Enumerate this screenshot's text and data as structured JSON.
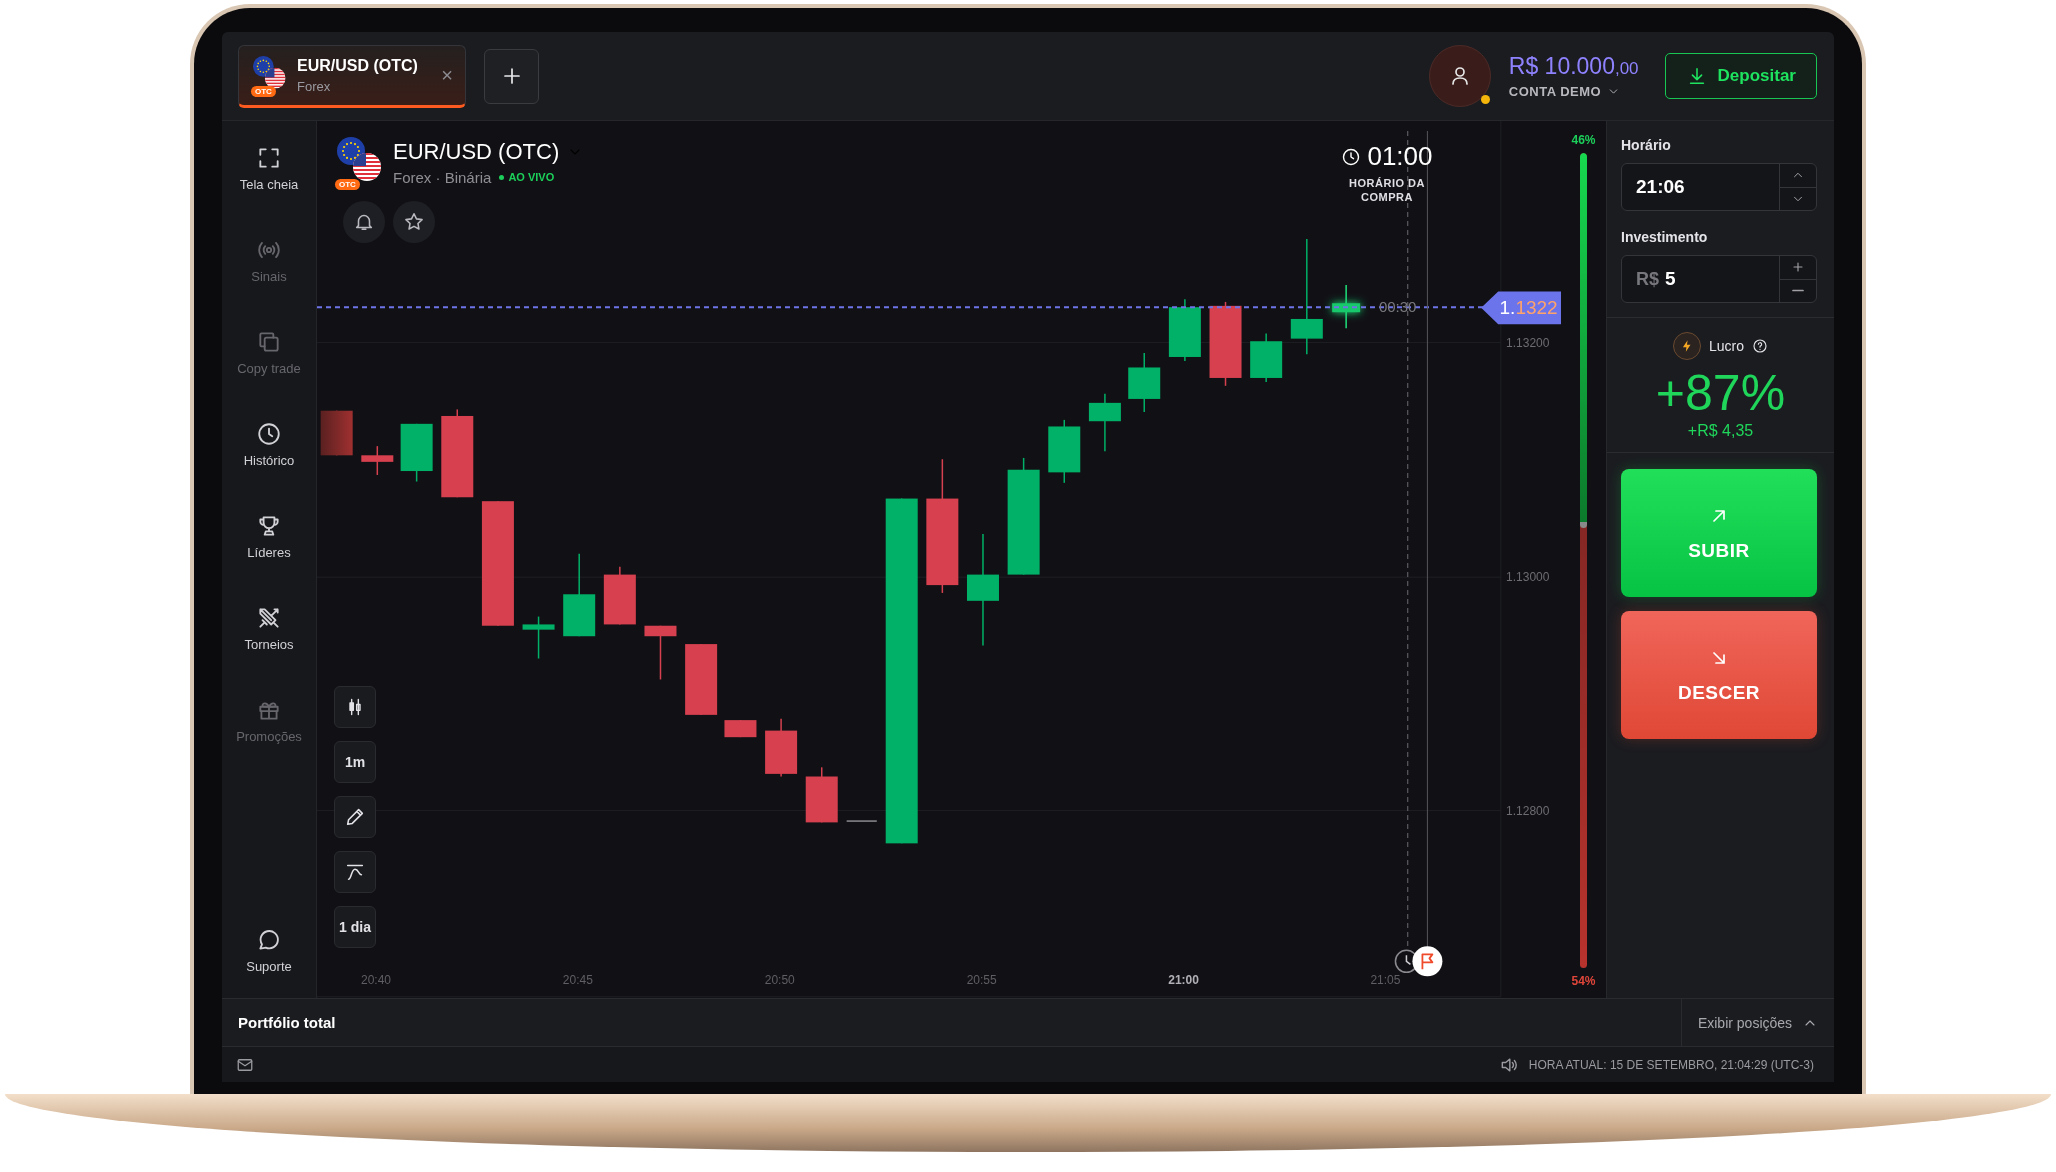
{
  "tab": {
    "symbol": "EUR/USD (OTC)",
    "market": "Forex",
    "badge": "OTC",
    "close": "×",
    "selected": true
  },
  "account": {
    "balance": "R$ 10.000",
    "cents": ",00",
    "type": "CONTA DEMO"
  },
  "deposit_button": "Depositar",
  "sidebar": {
    "items": [
      {
        "label": "Tela cheia",
        "disabled": false
      },
      {
        "label": "Sinais",
        "disabled": true
      },
      {
        "label": "Copy trade",
        "disabled": true
      },
      {
        "label": "Histórico",
        "disabled": false
      },
      {
        "label": "Líderes",
        "disabled": false
      },
      {
        "label": "Torneios",
        "disabled": false
      },
      {
        "label": "Promoções",
        "disabled": true
      }
    ],
    "footer": {
      "label": "Suporte",
      "disabled": false
    }
  },
  "asset": {
    "badge": "OTC",
    "name": "EUR/USD (OTC)",
    "market": "Forex · Binária",
    "status": "AO VIVO"
  },
  "timer": {
    "value": "01:00",
    "label": "HORÁRIO DA COMPRA"
  },
  "chart": {
    "price_prefix": "1.",
    "price_digits": "1322",
    "countdown": "00:30",
    "y_labels": [
      "1.13200",
      "1.13000",
      "1.12800"
    ],
    "x_labels": [
      {
        "label": "20:40",
        "bold": false
      },
      {
        "label": "20:45",
        "bold": false
      },
      {
        "label": "20:50",
        "bold": false
      },
      {
        "label": "20:55",
        "bold": false
      },
      {
        "label": "21:00",
        "bold": true
      },
      {
        "label": "21:05",
        "bold": false
      }
    ]
  },
  "chart_tools": [
    "1m",
    "1 dia"
  ],
  "sentiment": {
    "up": "46%",
    "down": "54%",
    "level": 0.46
  },
  "trade": {
    "time_label": "Horário",
    "time": "21:06",
    "amount_label": "Investimento",
    "currency": "R$",
    "amount": "5",
    "profit_label": "Lucro",
    "profit_percent": "+87%",
    "profit_value": "+R$ 4,35",
    "up_button": "SUBIR",
    "down_button": "DESCER"
  },
  "portfolio": {
    "title": "Portfólio total",
    "toggle": "Exibir posições"
  },
  "status_bar": {
    "clock": "HORA ATUAL: 15 DE SETEMBRO, 21:04:29 (UTC-3)"
  }
}
